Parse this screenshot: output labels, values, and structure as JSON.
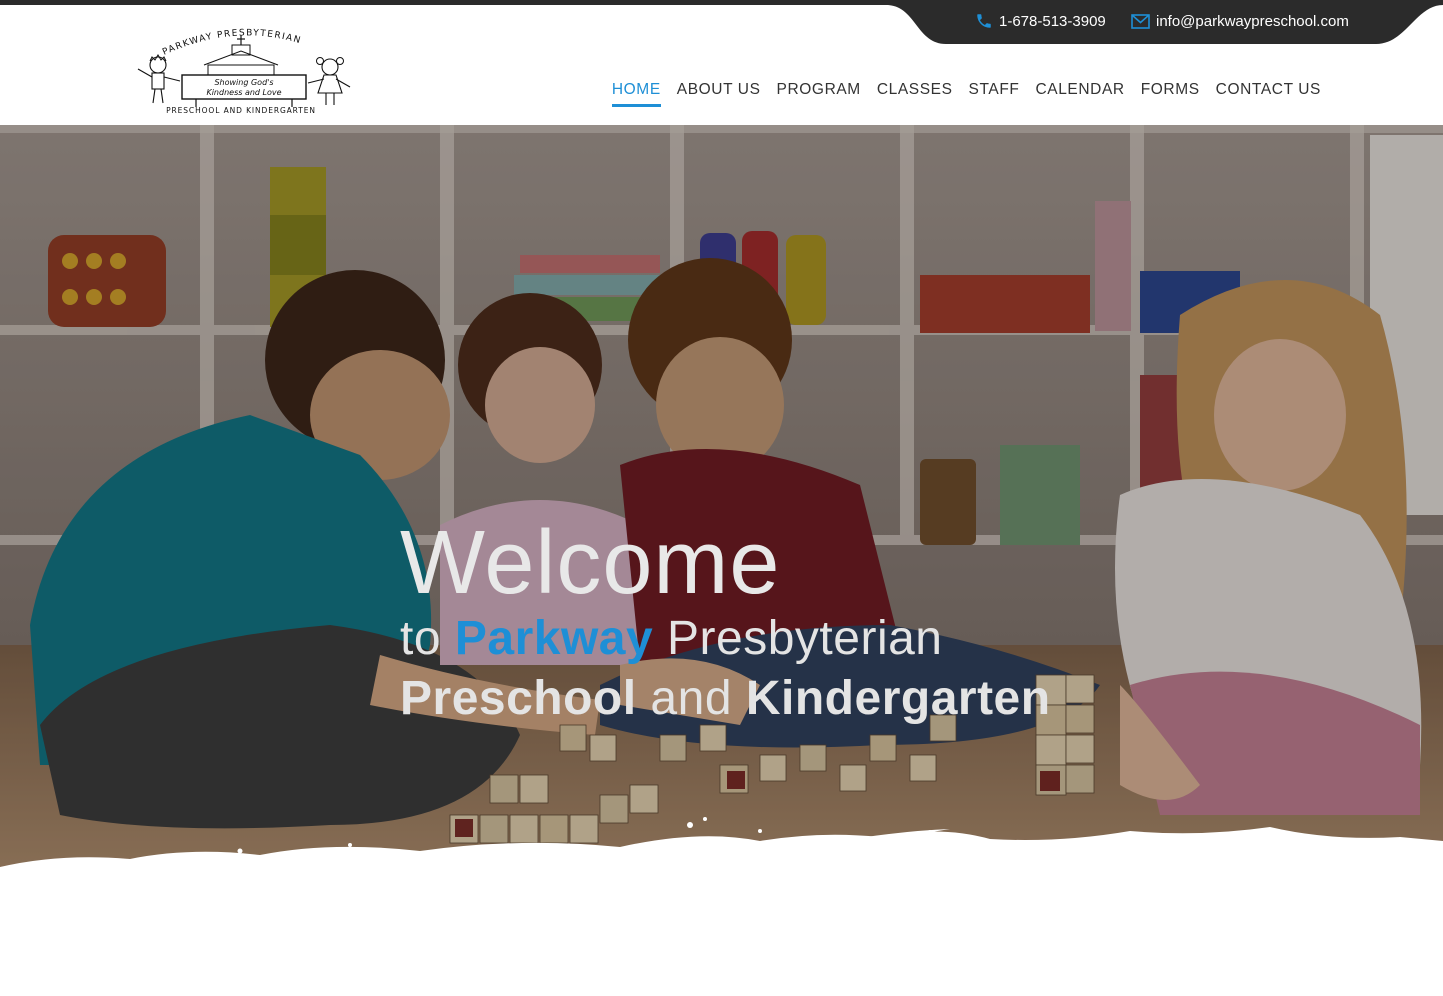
{
  "contact": {
    "phone": "1-678-513-3909",
    "email": "info@parkwaypreschool.com",
    "phone_icon": "phone-icon",
    "email_icon": "envelope-icon"
  },
  "logo": {
    "top_text": "PARKWAY PRESBYTERIAN",
    "sign_line1": "Showing God's",
    "sign_line2": "Kindness and Love",
    "bottom_text": "PRESCHOOL AND KINDERGARTEN"
  },
  "nav": {
    "items": [
      {
        "label": "HOME",
        "active": true
      },
      {
        "label": "ABOUT US",
        "active": false
      },
      {
        "label": "PROGRAM",
        "active": false
      },
      {
        "label": "CLASSES",
        "active": false
      },
      {
        "label": "STAFF",
        "active": false
      },
      {
        "label": "CALENDAR",
        "active": false
      },
      {
        "label": "FORMS",
        "active": false
      },
      {
        "label": "CONTACT US",
        "active": false
      }
    ]
  },
  "hero": {
    "welcome": "Welcome",
    "to": "to",
    "parkway": "Parkway",
    "presbyterian": "Presbyterian",
    "preschool": "Preschool",
    "and": "and",
    "kindergarten": "Kindergarten"
  },
  "colors": {
    "accent": "#1e8fd6",
    "dark_bar": "#2b2b2b"
  }
}
